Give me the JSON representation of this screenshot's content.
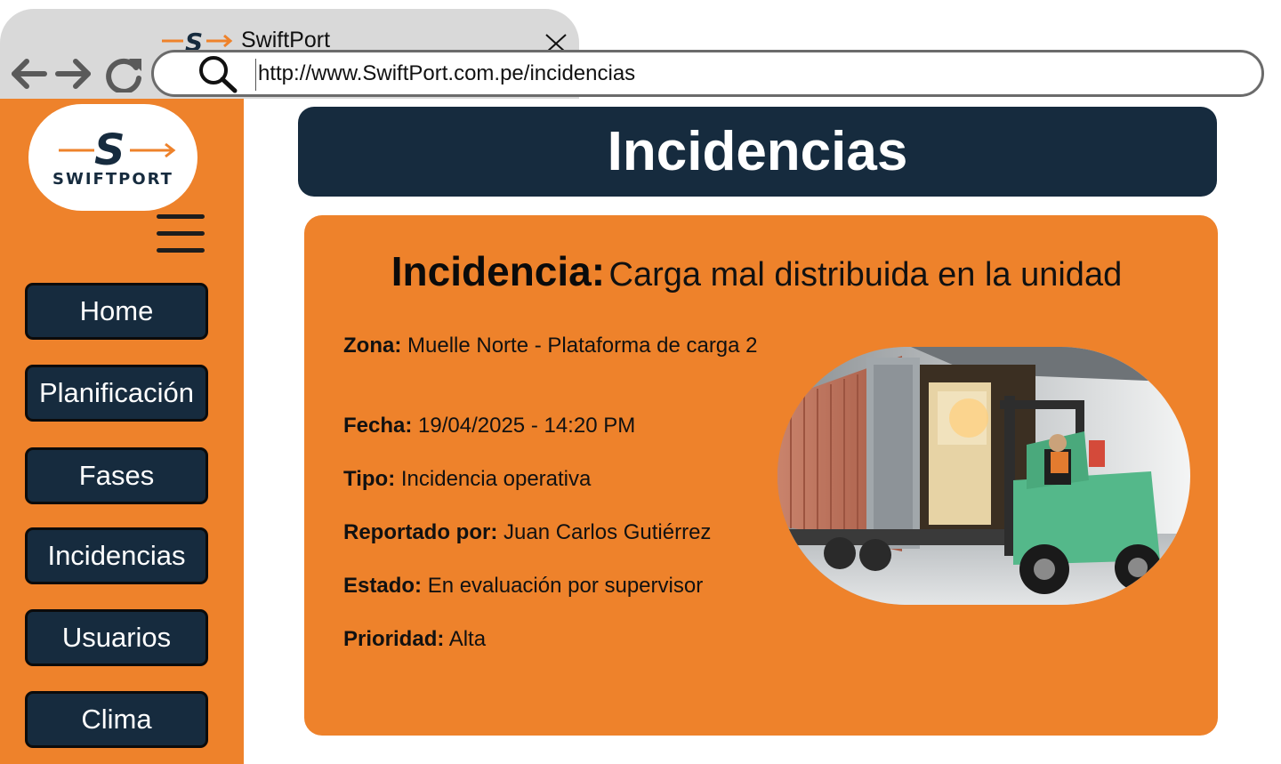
{
  "browser": {
    "tab_title": "SwiftPort",
    "url": "http://www.SwiftPort.com.pe/incidencias"
  },
  "brand": {
    "logo_letter": "S",
    "name": "SWIFTPORT",
    "colors": {
      "primary": "#162b3e",
      "accent": "#ee822b"
    }
  },
  "icons": {
    "back": "arrow-left-icon",
    "forward": "arrow-right-icon",
    "reload": "reload-icon",
    "search": "search-icon",
    "close": "close-icon",
    "menu": "hamburger-menu-icon"
  },
  "sidebar": {
    "items": [
      {
        "label": "Home"
      },
      {
        "label": "Planificación"
      },
      {
        "label": "Fases"
      },
      {
        "label": "Incidencias"
      },
      {
        "label": "Usuarios"
      },
      {
        "label": "Clima"
      }
    ]
  },
  "page": {
    "title": "Incidencias"
  },
  "incident": {
    "heading_label": "Incidencia:",
    "heading_value": "Carga mal distribuida en la unidad",
    "fields": [
      {
        "label": "Zona:",
        "value": "Muelle Norte - Plataforma de carga 2"
      },
      {
        "label": "Fecha:",
        "value": "19/04/2025 - 14:20 PM"
      },
      {
        "label": "Tipo:",
        "value": "Incidencia operativa"
      },
      {
        "label": "Reportado por:",
        "value": "Juan Carlos Gutiérrez"
      },
      {
        "label": "Estado:",
        "value": "En evaluación por supervisor"
      },
      {
        "label": "Prioridad:",
        "value": "Alta"
      }
    ],
    "photo": "forklift-loading-container-photo"
  }
}
